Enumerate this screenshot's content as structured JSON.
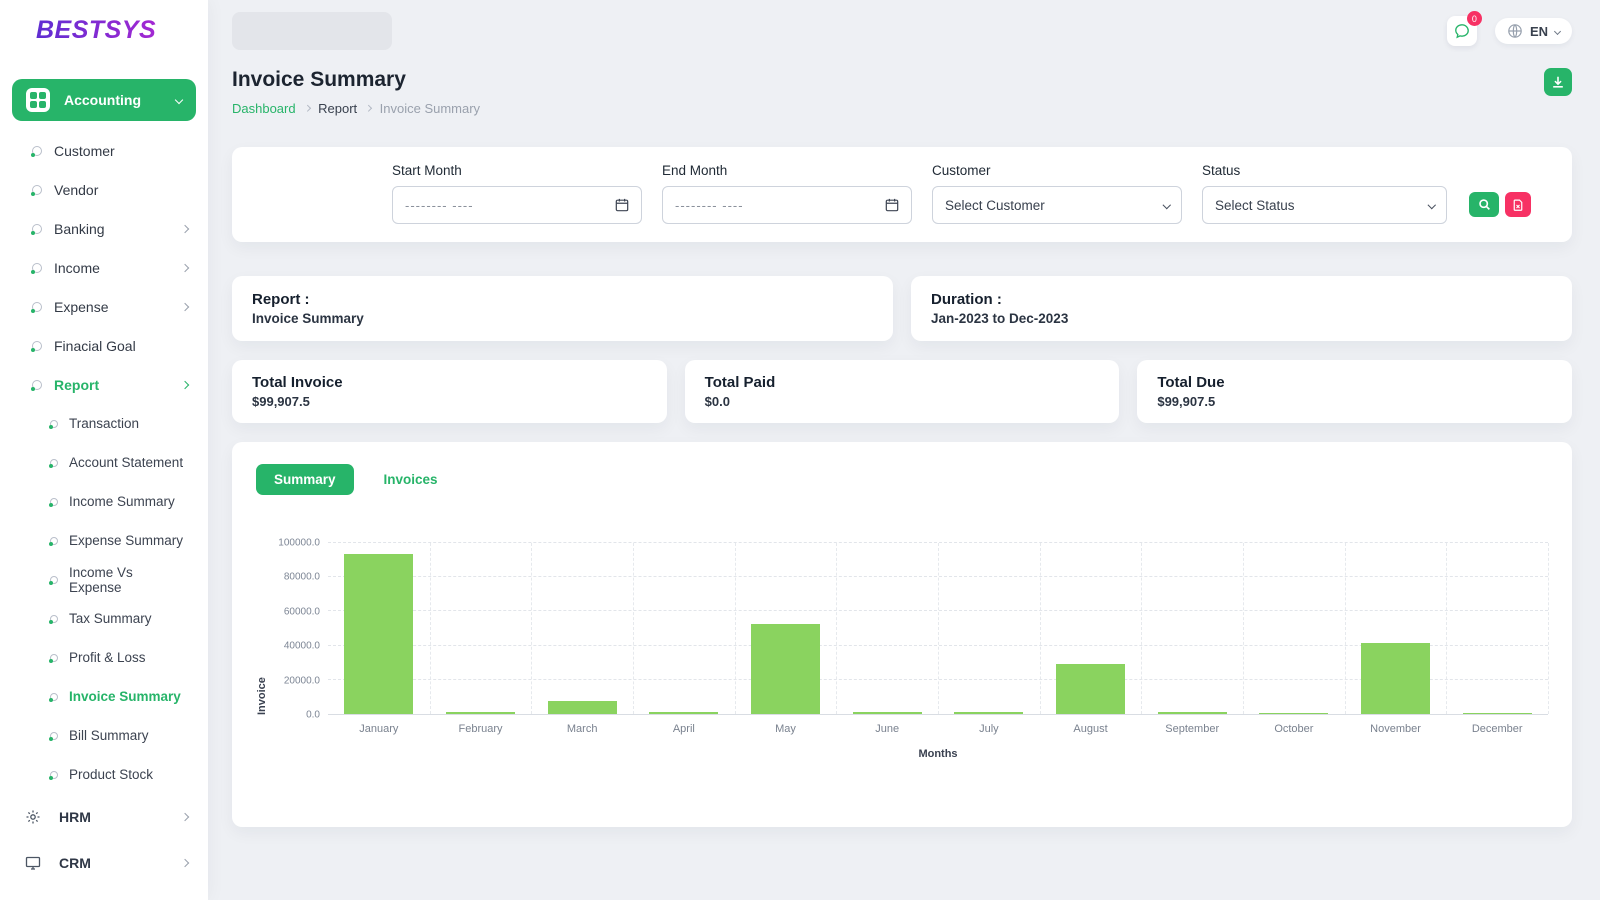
{
  "brand": {
    "name": "BESTSYS"
  },
  "topbar": {
    "chat_badge": "0",
    "language": "EN"
  },
  "sidebar": {
    "modules": {
      "accounting": "Accounting",
      "hrm": "HRM",
      "crm": "CRM"
    },
    "accounting_items": [
      {
        "label": "Customer"
      },
      {
        "label": "Vendor"
      },
      {
        "label": "Banking"
      },
      {
        "label": "Income"
      },
      {
        "label": "Expense"
      },
      {
        "label": "Finacial Goal"
      },
      {
        "label": "Report"
      }
    ],
    "report_items": [
      {
        "label": "Transaction"
      },
      {
        "label": "Account Statement"
      },
      {
        "label": "Income Summary"
      },
      {
        "label": "Expense Summary"
      },
      {
        "label": "Income Vs Expense"
      },
      {
        "label": "Tax Summary"
      },
      {
        "label": "Profit & Loss"
      },
      {
        "label": "Invoice Summary"
      },
      {
        "label": "Bill Summary"
      },
      {
        "label": "Product Stock"
      }
    ]
  },
  "page": {
    "title": "Invoice Summary",
    "breadcrumb": {
      "home": "Dashboard",
      "section": "Report",
      "current": "Invoice Summary"
    }
  },
  "filters": {
    "start_month_label": "Start Month",
    "end_month_label": "End Month",
    "customer_label": "Customer",
    "status_label": "Status",
    "date_placeholder": "-------- ----",
    "customer_value": "Select Customer",
    "status_value": "Select Status"
  },
  "info": {
    "report_label": "Report :",
    "report_value": "Invoice Summary",
    "duration_label": "Duration :",
    "duration_value": "Jan-2023 to Dec-2023"
  },
  "stats": [
    {
      "label": "Total Invoice",
      "value": "$99,907.5"
    },
    {
      "label": "Total Paid",
      "value": "$0.0"
    },
    {
      "label": "Total Due",
      "value": "$99,907.5"
    }
  ],
  "tabs": {
    "summary": "Summary",
    "invoices": "Invoices"
  },
  "chart_data": {
    "type": "bar",
    "title": "",
    "categories": [
      "January",
      "February",
      "March",
      "April",
      "May",
      "June",
      "July",
      "August",
      "September",
      "October",
      "November",
      "December"
    ],
    "values": [
      93500,
      1200,
      7800,
      1200,
      52500,
      900,
      900,
      29500,
      900,
      600,
      41500,
      700
    ],
    "xlabel": "Months",
    "ylabel": "Invoice",
    "ylim": [
      0,
      100000
    ],
    "yticks": [
      0,
      20000,
      40000,
      60000,
      80000,
      100000
    ],
    "bar_color": "#8ad35f",
    "grid": "dashed",
    "legend_position": "none"
  },
  "colors": {
    "accent": "#27b469",
    "danger": "#f73164",
    "bar": "#8ad35f"
  }
}
